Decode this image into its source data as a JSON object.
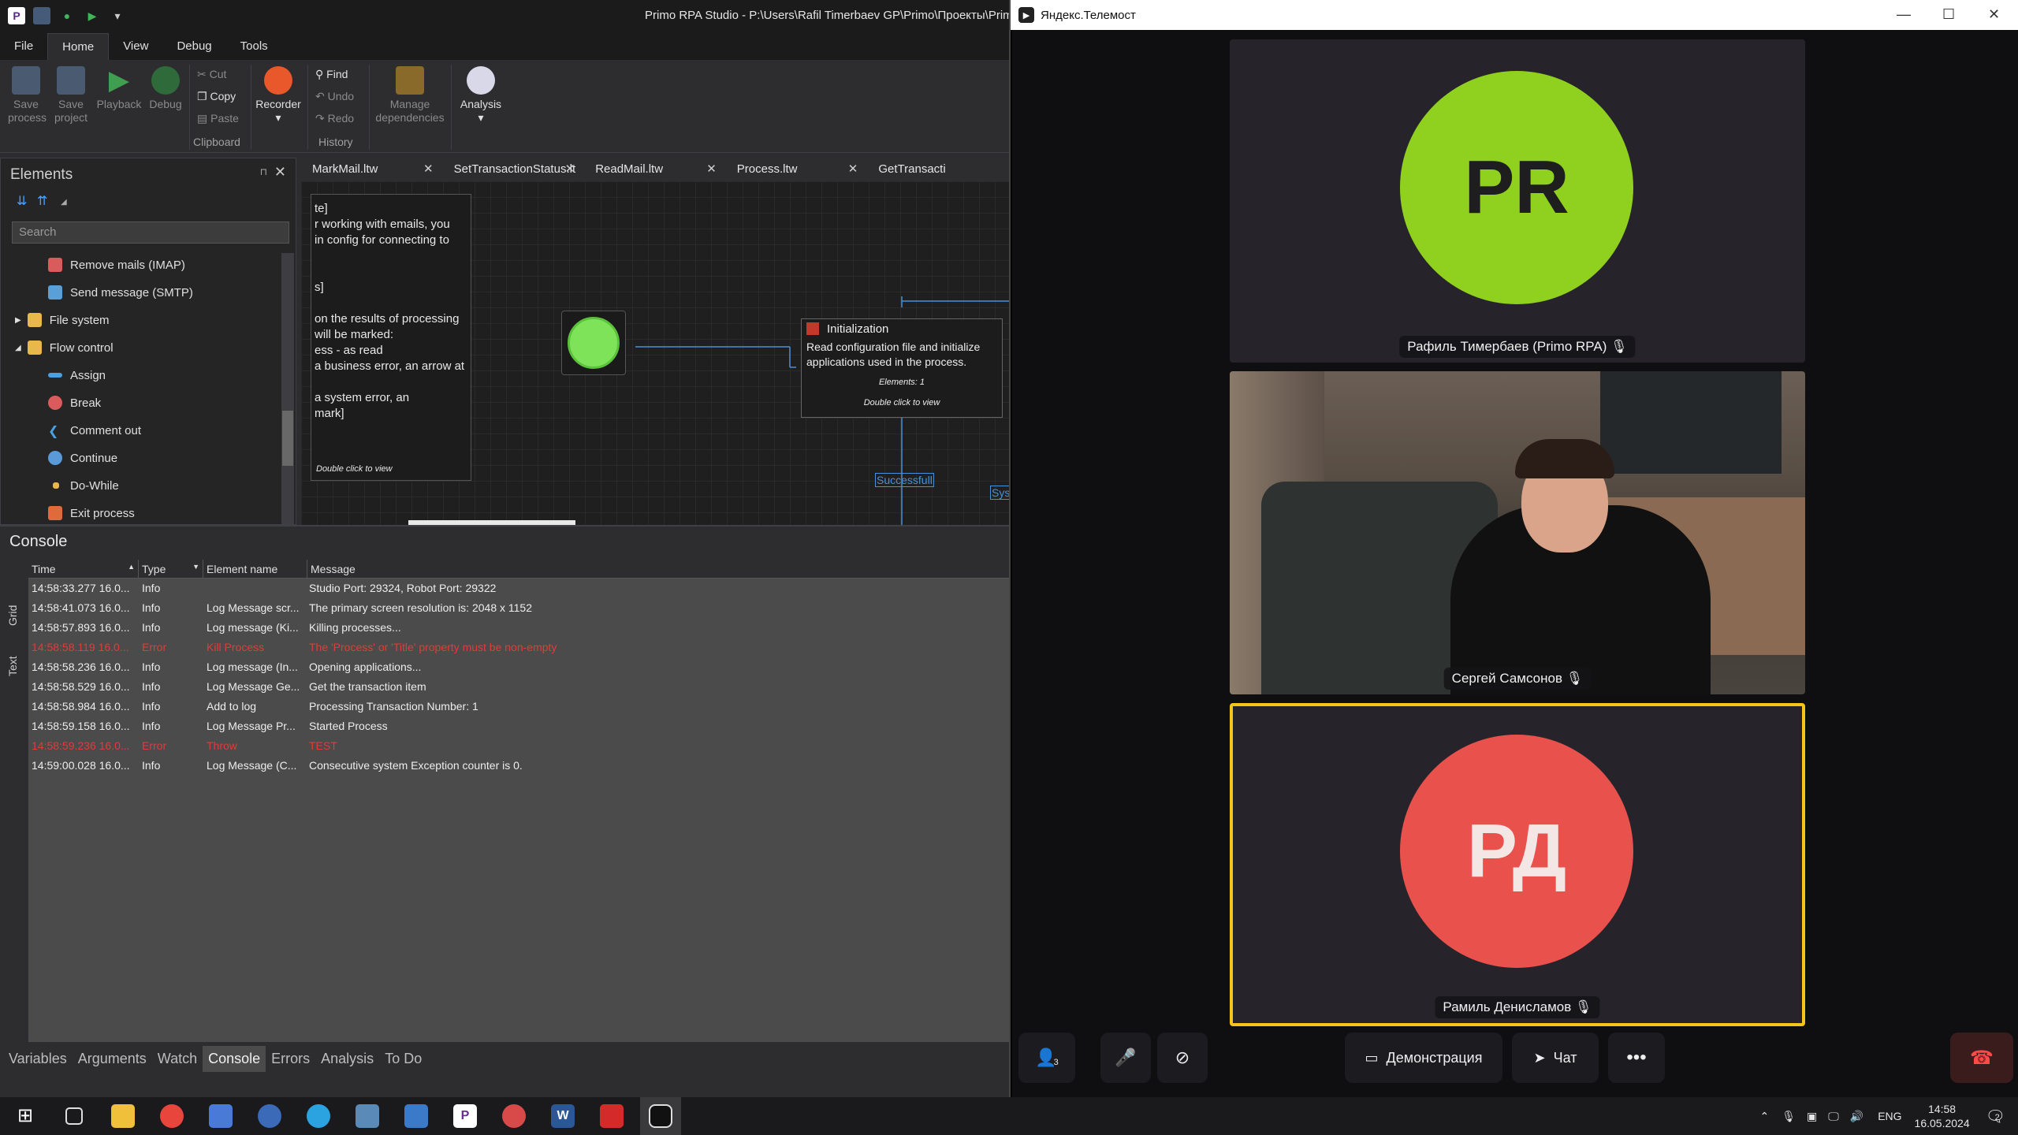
{
  "studio": {
    "window_title": "Primo RPA Studio - P:\\Users\\Rafil Timerbaev GP\\Primo\\Проекты\\Prim",
    "menu": [
      "File",
      "Home",
      "View",
      "Debug",
      "Tools"
    ],
    "ribbon": {
      "save_process": "Save process",
      "save_project": "Save project",
      "playback": "Playback",
      "debug": "Debug",
      "cut": "Cut",
      "copy": "Copy",
      "paste": "Paste",
      "clipboard": "Clipboard",
      "recorder": "Recorder",
      "find": "Find",
      "undo": "Undo",
      "redo": "Redo",
      "history": "History",
      "manage_dependencies": "Manage dependencies",
      "analysis": "Analysis"
    },
    "elements": {
      "title": "Elements",
      "search_placeholder": "Search",
      "items": [
        {
          "label": "Remove mails (IMAP)",
          "icon": "mail-remove-icon",
          "color": "#d95b5b"
        },
        {
          "label": "Send message (SMTP)",
          "icon": "mail-send-icon",
          "color": "#5aa0d8"
        },
        {
          "label": "File system",
          "icon": "folder-icon",
          "color": "#e8b84a"
        },
        {
          "label": "Flow control",
          "icon": "folder-icon",
          "color": "#e8b84a"
        },
        {
          "label": "Assign",
          "icon": "assign-icon",
          "color": "#4aa0e0"
        },
        {
          "label": "Break",
          "icon": "break-icon",
          "color": "#d95b5b"
        },
        {
          "label": "Comment out",
          "icon": "comment-out-icon",
          "color": "#4aa0e0"
        },
        {
          "label": "Continue",
          "icon": "continue-icon",
          "color": "#5a9ad8"
        },
        {
          "label": "Do-While",
          "icon": "do-while-icon",
          "color": "#e8b84a"
        },
        {
          "label": "Exit process",
          "icon": "exit-process-icon",
          "color": "#e06a3a"
        }
      ]
    },
    "doc_tabs": [
      "MarkMail.ltw",
      "SetTransactionStatus.lt",
      "ReadMail.ltw",
      "Process.ltw",
      "GetTransacti"
    ],
    "canvas": {
      "note_lines": [
        "te]",
        "r working with emails, you",
        " in config for connecting to",
        "",
        "",
        "s]",
        "",
        "on the results of processing",
        " will be marked:",
        "ess - as read",
        "a business error, an arrow at",
        "",
        "a system error, an",
        "mark]"
      ],
      "note_footer": "Double click to view",
      "init_title": "Initialization",
      "init_desc": "Read configuration file and initialize applications used in the process.",
      "init_elements": "Elements: 1",
      "init_footer": "Double click to view",
      "successful": "Successfull",
      "sys": "Sys"
    },
    "console": {
      "title": "Console",
      "side_tabs": [
        "Grid",
        "Text"
      ],
      "columns": [
        "Time",
        "Type",
        "Element name",
        "Message"
      ],
      "rows": [
        {
          "time": "14:58:33.277 16.0...",
          "type": "Info",
          "element": "",
          "message": "Studio Port: 29324, Robot Port: 29322",
          "error": false
        },
        {
          "time": "14:58:41.073 16.0...",
          "type": "Info",
          "element": "Log Message scr...",
          "message": "The primary screen resolution is: 2048 x 1152",
          "error": false
        },
        {
          "time": "14:58:57.893 16.0...",
          "type": "Info",
          "element": "Log message (Ki...",
          "message": "Killing processes...",
          "error": false
        },
        {
          "time": "14:58:58.119 16.0...",
          "type": "Error",
          "element": "Kill Process",
          "message": "The 'Process' or 'Title' property must be non-empty",
          "error": true
        },
        {
          "time": "14:58:58.236 16.0...",
          "type": "Info",
          "element": "Log message (In...",
          "message": "Opening applications...",
          "error": false
        },
        {
          "time": "14:58:58.529 16.0...",
          "type": "Info",
          "element": "Log Message Ge...",
          "message": "Get the transaction item",
          "error": false
        },
        {
          "time": "14:58:58.984 16.0...",
          "type": "Info",
          "element": "Add to log",
          "message": "Processing Transaction Number: 1",
          "error": false
        },
        {
          "time": "14:58:59.158 16.0...",
          "type": "Info",
          "element": "Log Message Pr...",
          "message": "Started Process",
          "error": false
        },
        {
          "time": "14:58:59.236 16.0...",
          "type": "Error",
          "element": "Throw",
          "message": "TEST",
          "error": true
        },
        {
          "time": "14:59:00.028 16.0...",
          "type": "Info",
          "element": "Log Message (C...",
          "message": "Consecutive system Exception counter is 0.",
          "error": false
        }
      ]
    },
    "bottom_tabs": [
      "Variables",
      "Arguments",
      "Watch",
      "Console",
      "Errors",
      "Analysis",
      "To Do"
    ]
  },
  "telemost": {
    "window_title": "Яндекс.Телемост",
    "participants": [
      {
        "initials": "PR",
        "name": "Рафиль Тимербаев (Primo RPA)",
        "color": "#8fd11e",
        "text_color": "#1e1e1e"
      },
      {
        "initials": "",
        "name": "Сергей Самсонов",
        "color": "",
        "text_color": ""
      },
      {
        "initials": "РД",
        "name": "Рамиль Денисламов",
        "color": "#e8514c",
        "text_color": "#f5e6e6"
      }
    ],
    "controls": {
      "demo": "Демонстрация",
      "chat": "Чат",
      "invite_badge": "3"
    }
  },
  "taskbar": {
    "lang": "ENG",
    "time": "14:58",
    "date": "16.05.2024",
    "notif_count": "2"
  }
}
